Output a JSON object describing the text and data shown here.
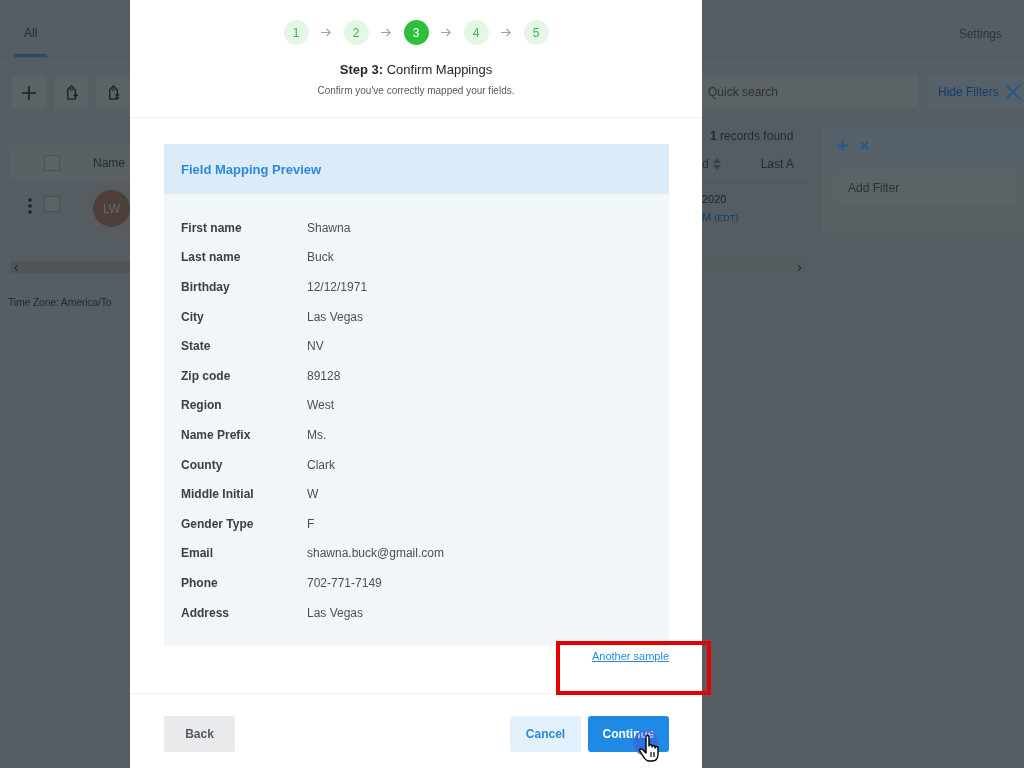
{
  "background": {
    "tabs": [
      {
        "label": "All",
        "selected": true
      }
    ],
    "toolbar": [
      {
        "kind": "add"
      },
      {
        "kind": "tag-add"
      },
      {
        "kind": "tag-remove"
      }
    ],
    "table": {
      "columns": [
        "Name",
        "d",
        "Last A"
      ],
      "header_checkbox": {
        "checked": false
      },
      "row": {
        "checked": false,
        "avatar": "LW",
        "date": "2020",
        "time": "M",
        "zone": "(EDT)"
      },
      "scroll_left": "‹",
      "scroll_right": "›"
    },
    "time_zone": "Time Zone: America/To",
    "settings": "Settings",
    "search": {
      "placeholder": "Quick search"
    },
    "hide_filters": "Hide Filters",
    "records_found": "**1** records found",
    "filter": {
      "placeholder": "Add Filter"
    }
  },
  "modal": {
    "steps": [
      {
        "label": "1",
        "selected": false
      },
      {
        "label": "2",
        "selected": false
      },
      {
        "label": "3",
        "selected": true
      },
      {
        "label": "4",
        "selected": false
      },
      {
        "label": "5",
        "selected": false
      }
    ],
    "title": "**Step 3:** Confirm Mappings",
    "subtitle": "Confirm you've correctly mapped your fields.",
    "preview": {
      "title": "Field Mapping Preview",
      "fields": [
        {
          "label": "First name",
          "value": "Shawna"
        },
        {
          "label": "Last name",
          "value": "Buck"
        },
        {
          "label": "Birthday",
          "value": "12/12/1971"
        },
        {
          "label": "City",
          "value": "Las Vegas"
        },
        {
          "label": "State",
          "value": "NV"
        },
        {
          "label": "Zip code",
          "value": "89128"
        },
        {
          "label": "Region",
          "value": "West"
        },
        {
          "label": "Name Prefix",
          "value": "Ms."
        },
        {
          "label": "County",
          "value": "Clark"
        },
        {
          "label": "Middle Initial",
          "value": "W"
        },
        {
          "label": "Gender Type",
          "value": "F"
        },
        {
          "label": "Email",
          "value": "shawna.buck@gmail.com"
        },
        {
          "label": "Phone",
          "value": "702-771-7149"
        },
        {
          "label": "Address",
          "value": "Las Vegas"
        }
      ]
    },
    "another_sample": "Another sample",
    "buttons": [
      {
        "label": "Back",
        "kind": "secondary"
      },
      {
        "label": "Cancel",
        "kind": "light"
      },
      {
        "label": "Continue",
        "kind": "primary"
      }
    ]
  }
}
